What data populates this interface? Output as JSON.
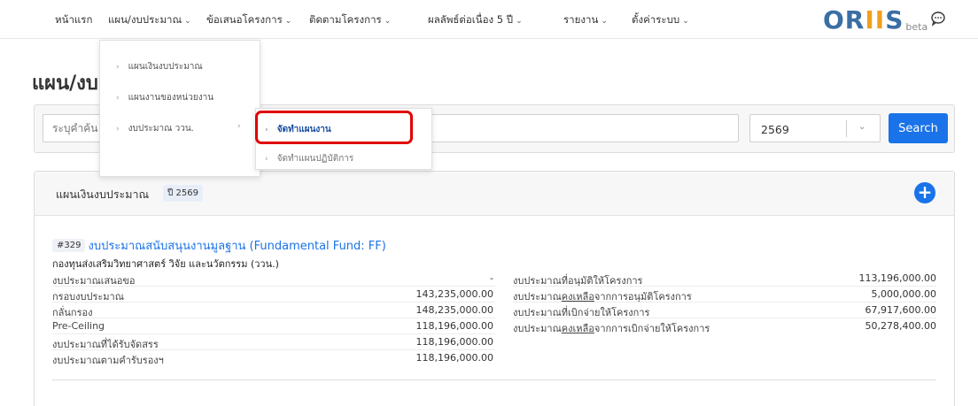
{
  "nav": {
    "items": [
      {
        "label": "หน้าแรก",
        "has_chevron": false
      },
      {
        "label": "แผน/งบประมาณ",
        "has_chevron": true
      },
      {
        "label": "ข้อเสนอโครงการ",
        "has_chevron": true
      },
      {
        "label": "ติดตามโครงการ",
        "has_chevron": true
      },
      {
        "label": "ผลลัพธ์ต่อเนื่อง 5 ปี",
        "has_chevron": true
      },
      {
        "label": "รายงาน",
        "has_chevron": true
      },
      {
        "label": "ตั้งค่าระบบ",
        "has_chevron": true
      }
    ],
    "logo_main": "OR",
    "logo_ii": "II",
    "logo_s": "S",
    "logo_sub": "beta",
    "chat_icon": "chat-bubble-icon"
  },
  "page": {
    "title": "แผน/งบ"
  },
  "search": {
    "placeholder": "ระบุคำค้น",
    "year": "2569",
    "button_label": "Search"
  },
  "dropdown": {
    "items": [
      {
        "label": "แผนเงินงบประมาณ"
      },
      {
        "label": "แผนงานของหน่วยงาน"
      },
      {
        "label": "งบประมาณ ววน."
      }
    ],
    "submenu": [
      {
        "label": "จัดทำแผนงาน",
        "active": true
      },
      {
        "label": "จัดทำแผนปฏิบัติการ",
        "active": false
      }
    ]
  },
  "card": {
    "title": "แผนเงินงบประมาณ",
    "year_badge": "ปี 2569",
    "add_icon": "plus-icon",
    "fund": {
      "id": "#329",
      "name": "งบประมาณสนับสนุนงานมูลฐาน (Fundamental Fund: FF)",
      "org": "กองทุนส่งเสริมวิทยาศาสตร์ วิจัย และนวัตกรรม (ววน.)"
    },
    "left_rows": [
      {
        "label": "งบประมาณเสนอขอ",
        "value": "-"
      },
      {
        "label": "กรอบงบประมาณ",
        "value": "143,235,000.00"
      },
      {
        "label": "กลั่นกรอง",
        "value": "148,235,000.00"
      },
      {
        "label": "Pre-Ceiling",
        "value": "118,196,000.00"
      },
      {
        "label": "งบประมาณที่ได้รับจัดสรร",
        "value": "118,196,000.00"
      },
      {
        "label": "งบประมาณตามคำรับรองฯ",
        "value": "118,196,000.00"
      }
    ],
    "right_rows": [
      {
        "pre": "งบประมาณที่อนุมัติให้โครงการ",
        "u": "",
        "post": "",
        "value": "113,196,000.00"
      },
      {
        "pre": "งบประมาณ",
        "u": "คงเหลือ",
        "post": "จากการอนุมัติโครงการ",
        "value": "5,000,000.00"
      },
      {
        "pre": "งบประมาณที่เบิกจ่ายให้โครงการ",
        "u": "",
        "post": "",
        "value": "67,917,600.00"
      },
      {
        "pre": "งบประมาณ",
        "u": "คงเหลือ",
        "post": "จากการเบิกจ่ายให้โครงการ",
        "value": "50,278,400.00"
      }
    ]
  }
}
